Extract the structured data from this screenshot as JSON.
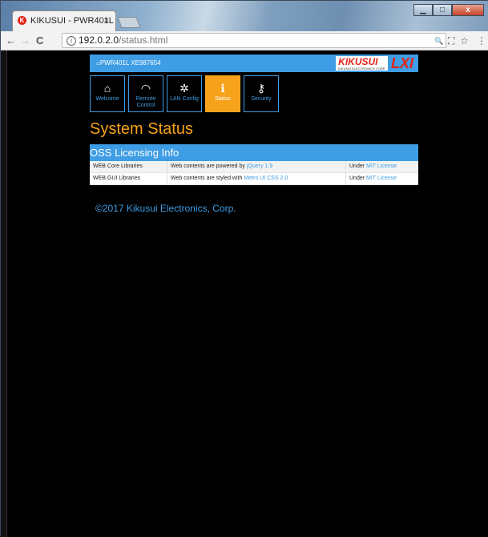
{
  "browser": {
    "tab_title": "KIKUSUI - PWR401L | ",
    "tab_close": "×",
    "url_host": "192.0.2.0",
    "url_path": "/status.html",
    "info_icon_glyph": "i",
    "back_glyph": "←",
    "forward_glyph": "→",
    "reload_glyph": "C",
    "zoom_glyph": "🔍",
    "translate_glyph": "⛶",
    "star_glyph": "☆",
    "menu_glyph": "⋮",
    "min_glyph": "▁",
    "max_glyph": "□",
    "close_glyph": "x"
  },
  "header": {
    "device_id": "PWR401L XE987654",
    "home_glyph": "⌂",
    "logo_text": "KIKUSUI",
    "logo_subtext": "KIKUSUI ELECTRONICS CORP.",
    "lxi_text": "LXI"
  },
  "nav": {
    "tiles": [
      {
        "label": "Welcome",
        "icon": "home-icon",
        "glyph": "⌂"
      },
      {
        "label": "Remote Control",
        "icon": "gauge-icon",
        "glyph": "◠"
      },
      {
        "label": "LAN Config",
        "icon": "gear-icon",
        "glyph": "✲"
      },
      {
        "label": "Status",
        "icon": "info-icon",
        "glyph": "ℹ"
      },
      {
        "label": "Security",
        "icon": "key-icon",
        "glyph": "⚷"
      }
    ],
    "active": "Status"
  },
  "main": {
    "page_title": "System Status",
    "section_title": "OSS Licensing Info",
    "rows": [
      {
        "name": "WEB Core Libraries",
        "desc_prefix": "Web contents are powered by ",
        "desc_link": "jQuery 1.9",
        "license_prefix": "Under ",
        "license_link": "MIT License"
      },
      {
        "name": "WEB GUI Libraries",
        "desc_prefix": "Web contents are styled with ",
        "desc_link": "Metro UI CSS 2.0",
        "license_prefix": "Under ",
        "license_link": "MIT License"
      }
    ]
  },
  "footer": {
    "copyright": "©2017 Kikusui Electronics, Corp."
  },
  "colors": {
    "accent_blue": "#3e9de4",
    "accent_orange": "#f7a21b",
    "brand_red": "#e2231a",
    "page_bg": "#000000"
  }
}
